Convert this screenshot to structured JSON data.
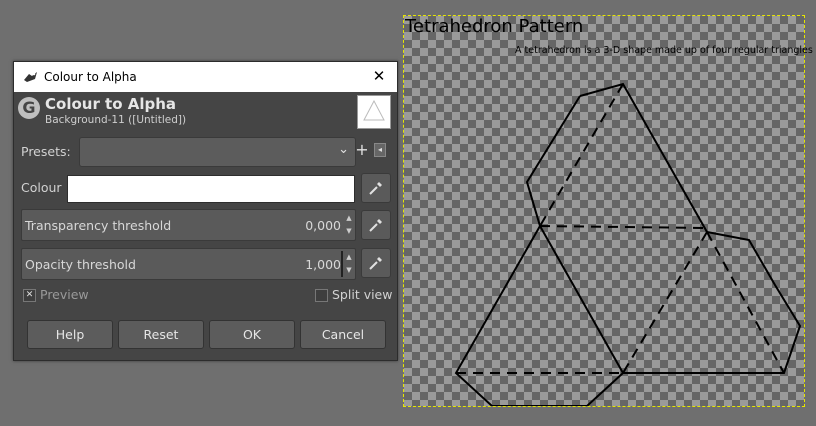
{
  "canvas": {
    "title": "Tetrahedron Pattern",
    "subtitle": "A tetrahedron is a 3-D shape made up of four regular triangles"
  },
  "dialog": {
    "window_title": "Colour to Alpha",
    "close_glyph": "✕",
    "header_title": "Colour to Alpha",
    "header_subtitle": "Background-11 ([Untitled])",
    "presets_label": "Presets:",
    "presets_value": "",
    "add_glyph": "+",
    "menu_glyph": "◂",
    "colour_label": "Colour",
    "colour_value": "#ffffff",
    "transparency_label": "Transparency threshold",
    "transparency_value": "0,000",
    "opacity_label": "Opacity threshold",
    "opacity_value": "1,000",
    "preview_label": "Preview",
    "preview_checked": true,
    "split_label": "Split view",
    "split_checked": false,
    "buttons": {
      "help": "Help",
      "reset": "Reset",
      "ok": "OK",
      "cancel": "Cancel"
    }
  }
}
